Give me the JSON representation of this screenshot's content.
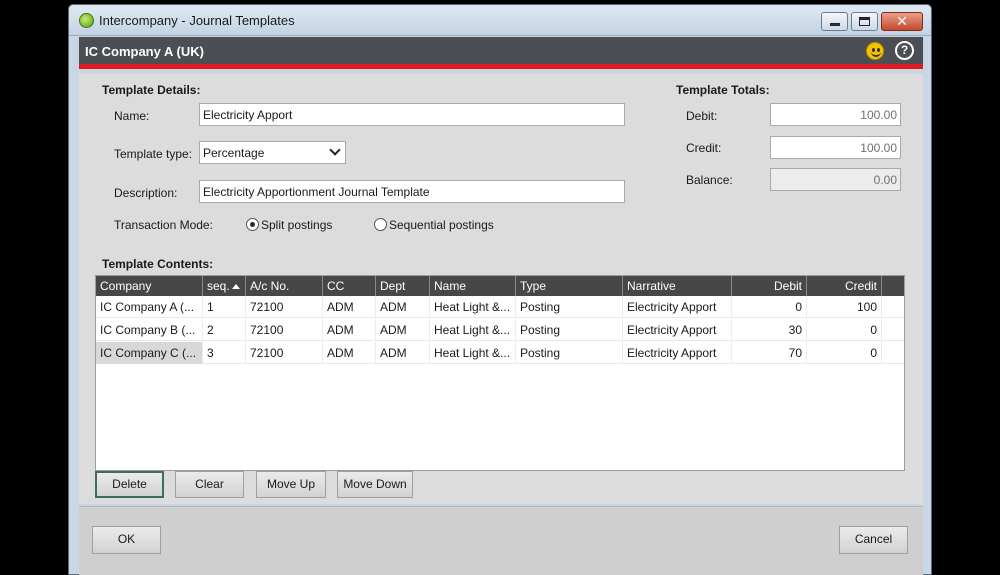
{
  "window": {
    "title": "Intercompany - Journal Templates",
    "company": "IC Company A (UK)"
  },
  "details": {
    "heading": "Template Details:",
    "name_label": "Name:",
    "name_value": "Electricity Apport",
    "type_label": "Template type:",
    "type_value": "Percentage",
    "description_label": "Description:",
    "description_value": "Electricity Apportionment Journal Template",
    "mode_label": "Transaction Mode:",
    "mode_split": "Split postings",
    "mode_sequential": "Sequential postings",
    "mode_selected": "split"
  },
  "totals": {
    "heading": "Template Totals:",
    "debit_label": "Debit:",
    "debit_value": "100.00",
    "credit_label": "Credit:",
    "credit_value": "100.00",
    "balance_label": "Balance:",
    "balance_value": "0.00"
  },
  "contents": {
    "heading": "Template Contents:",
    "columns": [
      "Company",
      "seq.",
      "A/c No.",
      "CC",
      "Dept",
      "Name",
      "Type",
      "Narrative",
      "Debit",
      "Credit"
    ],
    "rows": [
      [
        "IC Company A (...",
        "1",
        "72100",
        "ADM",
        "ADM",
        "Heat Light &...",
        "Posting",
        "Electricity Apport",
        "0",
        "100"
      ],
      [
        "IC Company B (...",
        "2",
        "72100",
        "ADM",
        "ADM",
        "Heat Light &...",
        "Posting",
        "Electricity Apport",
        "30",
        "0"
      ],
      [
        "IC Company C (...",
        "3",
        "72100",
        "ADM",
        "ADM",
        "Heat Light &...",
        "Posting",
        "Electricity Apport",
        "70",
        "0"
      ]
    ],
    "selected_row": 2
  },
  "buttons": {
    "delete": "Delete",
    "clear": "Clear",
    "move_up": "Move Up",
    "move_down": "Move Down",
    "ok": "OK",
    "cancel": "Cancel"
  },
  "colors": {
    "accent_red": "#e11b22",
    "header_dark": "#4b4e52"
  },
  "icons": [
    "app-logo-icon",
    "minimize-icon",
    "maximize-icon",
    "close-icon",
    "feedback-smiley-icon",
    "help-icon",
    "sort-ascending-icon",
    "chevron-down-icon"
  ]
}
